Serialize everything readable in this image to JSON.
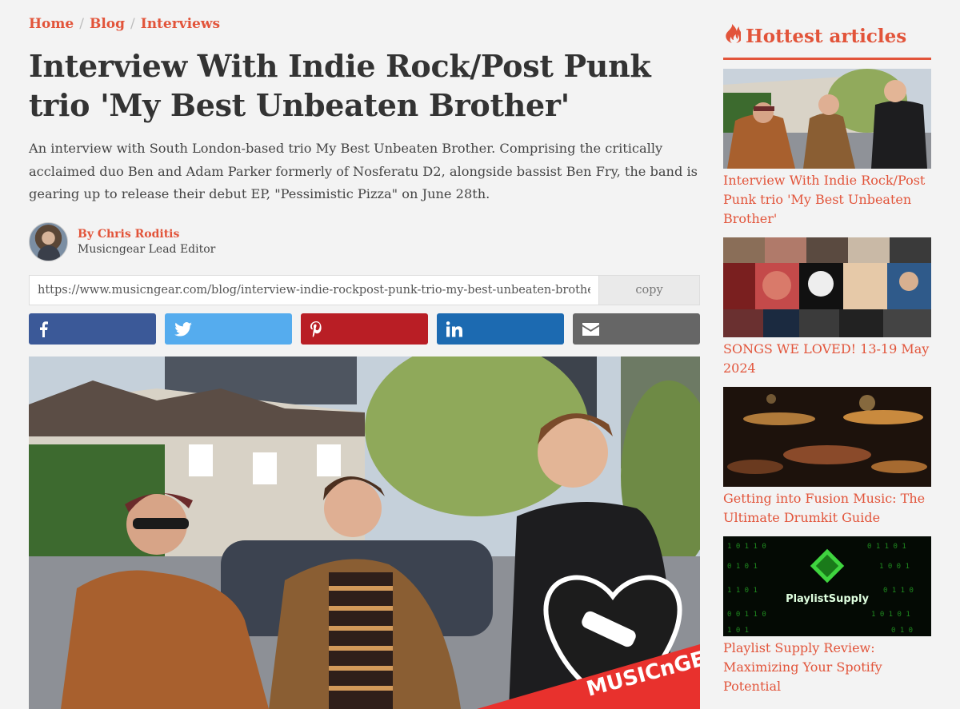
{
  "breadcrumb": {
    "items": [
      "Home",
      "Blog",
      "Interviews"
    ],
    "separator": "/"
  },
  "article": {
    "title": "Interview With Indie Rock/Post Punk trio 'My Best Unbeaten Brother'",
    "intro": "An interview with South London-based trio My Best Unbeaten Brother. Comprising the critically acclaimed duo Ben and Adam Parker formerly of Nosferatu D2, alongside bassist Ben Fry, the band is gearing up to release their debut EP, \"Pessimistic Pizza\" on June 28th.",
    "author_name": "By Chris Roditis",
    "author_role": "Musicngear Lead Editor",
    "share_url": "https://www.musicngear.com/blog/interview-indie-rockpost-punk-trio-my-best-unbeaten-brother",
    "copy_label": "copy",
    "share_buttons": [
      {
        "name": "facebook",
        "icon": "facebook-icon",
        "color": "#3b5998"
      },
      {
        "name": "twitter",
        "icon": "twitter-icon",
        "color": "#55acee"
      },
      {
        "name": "pinterest",
        "icon": "pinterest-icon",
        "color": "#b91e25"
      },
      {
        "name": "linkedin",
        "icon": "linkedin-icon",
        "color": "#1c6ab1"
      },
      {
        "name": "email",
        "icon": "mail-icon",
        "color": "#666666"
      }
    ],
    "hero_watermark": "MUSICnGEAR"
  },
  "sidebar": {
    "title": "Hottest articles",
    "title_icon": "fire-icon",
    "articles": [
      {
        "title": "Interview With Indie Rock/Post Punk trio 'My Best Unbeaten Brother'"
      },
      {
        "title": "SONGS WE LOVED! 13-19 May 2024"
      },
      {
        "title": "Getting into Fusion Music: The Ultimate Drumkit Guide"
      },
      {
        "title": "Playlist Supply Review: Maximizing Your Spotify Potential",
        "thumb_text": "PlaylistSupply"
      }
    ]
  },
  "colors": {
    "accent": "#e2543a",
    "background": "#f3f3f3",
    "text": "#333333"
  }
}
